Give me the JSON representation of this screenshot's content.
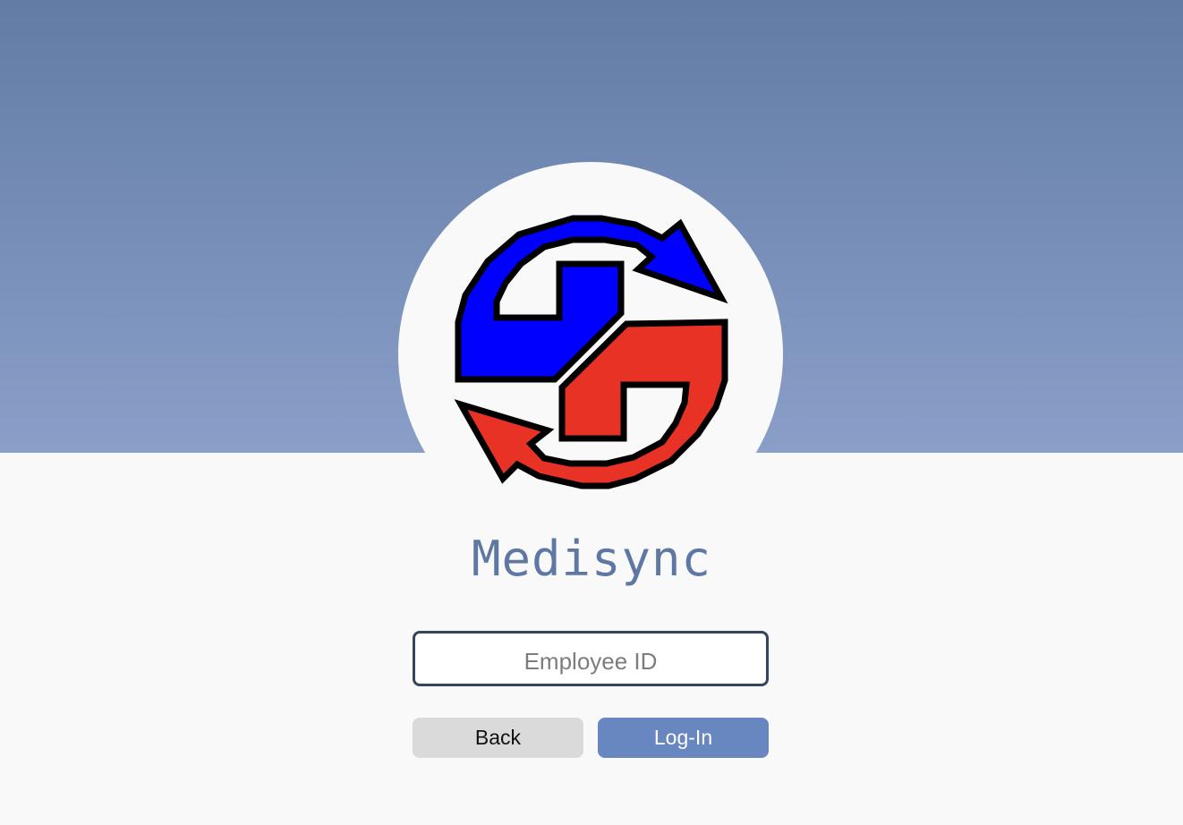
{
  "app": {
    "name": "Medisync",
    "logo": "medisync-sync-arrows-logo"
  },
  "login": {
    "employee_id_placeholder": "Employee ID",
    "employee_id_value": ""
  },
  "buttons": {
    "back_label": "Back",
    "login_label": "Log-In"
  },
  "colors": {
    "header_gradient_top": "#627ca6",
    "header_gradient_bottom": "#8a9fc8",
    "page_background": "#f9f9f9",
    "title": "#5f78a3",
    "logo_blue": "#0000ff",
    "logo_red": "#e83226",
    "login_button": "#6886c0",
    "back_button": "#dadada",
    "input_border": "#34455d"
  }
}
